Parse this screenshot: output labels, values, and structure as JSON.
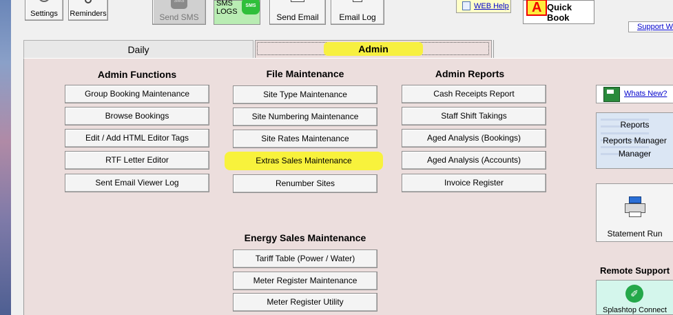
{
  "toolbar": {
    "settings": "Settings",
    "reminders": "Reminders",
    "send_sms": "Send SMS",
    "sms_icon_text": "SMS",
    "sms_logs": "SMS\nLOGS",
    "sms_bubble_text": "SMS",
    "send_email": "Send Email",
    "email_log": "Email Log",
    "web_help": "WEB Help",
    "quick_book": "Quick Book",
    "support": "Support W"
  },
  "tabs": {
    "daily": "Daily",
    "admin": "Admin"
  },
  "admin_functions": {
    "title": "Admin Functions",
    "items": [
      "Group Booking Maintenance",
      "Browse Bookings",
      "Edit / Add HTML Editor Tags",
      "RTF Letter Editor",
      "Sent Email Viewer Log"
    ]
  },
  "file_maintenance": {
    "title": "File Maintenance",
    "items": [
      "Site Type Maintenance",
      "Site Numbering Maintenance",
      "Site Rates Maintenance",
      "Extras Sales Maintenance",
      "Renumber Sites"
    ]
  },
  "admin_reports": {
    "title": "Admin Reports",
    "items": [
      "Cash Receipts Report",
      "Staff Shift Takings",
      "Aged Analysis (Bookings)",
      "Aged Analysis (Accounts)",
      "Invoice Register"
    ]
  },
  "energy_sales": {
    "title": "Energy Sales Maintenance",
    "items": [
      "Tariff Table (Power / Water)",
      "Meter Register Maintenance",
      "Meter Register Utility"
    ]
  },
  "side": {
    "whats_new": "Whats New?",
    "reports_line1": "Reports",
    "reports_line2": "Reports Manager",
    "reports_line3": "Manager",
    "statement_run": "Statement Run",
    "remote_support": "Remote Support",
    "splashtop_icon_text": "✐",
    "splashtop": "Splashtop Connect"
  },
  "colors": {
    "highlight": "#f8f23c",
    "panel": "#ecdedd",
    "link": "#0000cc"
  }
}
